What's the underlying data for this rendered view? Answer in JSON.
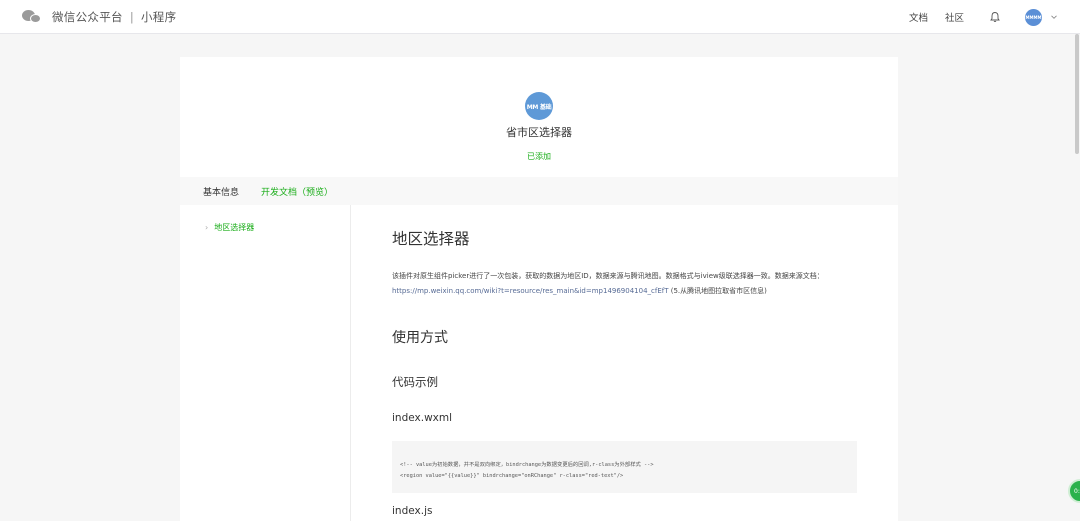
{
  "header": {
    "title": "微信公众平台",
    "separator": "|",
    "subtitle": "小程序",
    "nav": {
      "docs": "文档",
      "community": "社区"
    },
    "avatar_text": "MMMM"
  },
  "plugin": {
    "avatar_text": "MM 基础",
    "name": "省市区选择器",
    "status": "已添加"
  },
  "tabs": [
    {
      "label": "基本信息"
    },
    {
      "label": "开发文档（预览）"
    }
  ],
  "sidebar": {
    "arrow": "›",
    "item": "地区选择器"
  },
  "doc": {
    "title": "地区选择器",
    "desc_text": "该插件对原生组件picker进行了一次包装，获取的数据为地区ID，数据来源与腾讯地图。数据格式与iview级联选择器一致。数据来源文档：",
    "desc_link": "https://mp.weixin.qq.com/wiki?t=resource/res_main&id=mp1496904104_cfEfT",
    "desc_tail": " (5.从腾讯地图拉取省市区信息)",
    "usage_heading": "使用方式",
    "example_heading": "代码示例",
    "file1": "index.wxml",
    "code_line1": "<!-- value为初始数据，并不是双向绑定，bindrchange为数据变更后的回调,r-class为外部样式 -->",
    "code_line2": "<region value=\"{{value}}\" bindrchange=\"onRChange\" r-class=\"red-text\"/>",
    "file2": "index.js"
  },
  "float_button": {
    "label": "0:"
  },
  "colors": {
    "accent": "#1aad19",
    "link": "#576b95",
    "avatar": "#5e99d7"
  }
}
